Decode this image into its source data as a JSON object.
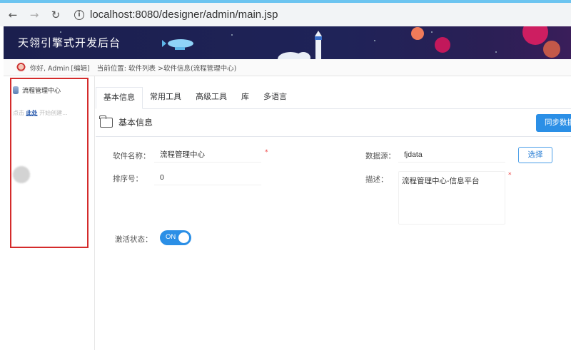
{
  "browser": {
    "url": "localhost:8080/designer/admin/main.jsp"
  },
  "header": {
    "title": "天翎引擎式开发后台"
  },
  "userbar": {
    "greeting": "你好, Admin",
    "edit_link": "[编辑]",
    "location": "当前位置: 软件列表 >软件信息(流程管理中心)"
  },
  "sidebar": {
    "tree_item": "流程管理中心",
    "hint_prefix": "点击",
    "hint_link": "此处",
    "hint_suffix": "开始创建..."
  },
  "tabs": [
    "基本信息",
    "常用工具",
    "高级工具",
    "库",
    "多语言"
  ],
  "section": {
    "title": "基本信息",
    "sync_button": "同步数据"
  },
  "form": {
    "name_label": "软件名称：",
    "name_value": "流程管理中心",
    "order_label": "排序号：",
    "order_value": "0",
    "datasource_label": "数据源：",
    "datasource_value": "fjdata",
    "select_button": "选择",
    "desc_label": "描述：",
    "desc_value": "流程管理中心-信息平台",
    "required_mark": "*",
    "active_label": "激活状态：",
    "active_value": "ON"
  },
  "colors": {
    "accent": "#2b8fe6",
    "header_bg": "#1b1f4e",
    "highlight_border": "#d42b2b"
  }
}
